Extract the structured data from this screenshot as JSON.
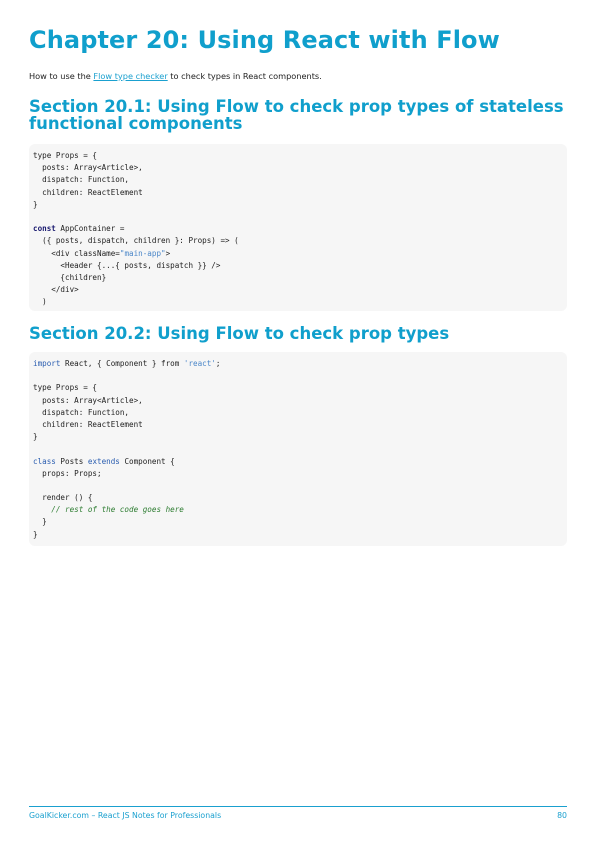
{
  "chapter": {
    "title": "Chapter 20: Using React with Flow"
  },
  "intro": {
    "before": "How to use the ",
    "link": "Flow type checker",
    "after": " to check types in React components."
  },
  "sections": [
    {
      "title": "Section 20.1: Using Flow to check prop types of stateless functional components",
      "code": [
        [
          [
            "",
            "type Props = {"
          ]
        ],
        [
          [
            "",
            "  posts: Array<Article>,"
          ]
        ],
        [
          [
            "",
            "  dispatch: Function,"
          ]
        ],
        [
          [
            "",
            "  children: ReactElement"
          ]
        ],
        [
          [
            "",
            "}"
          ]
        ],
        [
          [
            "",
            ""
          ]
        ],
        [
          [
            "kw",
            "const"
          ],
          [
            "",
            " AppContainer ="
          ]
        ],
        [
          [
            "",
            "  ({ posts, dispatch, children }: Props) => ("
          ]
        ],
        [
          [
            "",
            "    <div className="
          ],
          [
            "str",
            "\"main-app\""
          ],
          [
            "",
            ">"
          ]
        ],
        [
          [
            "",
            "      <Header {...{ posts, dispatch }} />"
          ]
        ],
        [
          [
            "",
            "      {children}"
          ]
        ],
        [
          [
            "",
            "    </div>"
          ]
        ],
        [
          [
            "",
            "  )"
          ]
        ]
      ]
    },
    {
      "title": "Section 20.2: Using Flow to check prop types",
      "code": [
        [
          [
            "kw2",
            "import"
          ],
          [
            "",
            " React, { Component } from "
          ],
          [
            "str",
            "'react'"
          ],
          [
            "",
            ";"
          ]
        ],
        [
          [
            "",
            ""
          ]
        ],
        [
          [
            "",
            "type Props = {"
          ]
        ],
        [
          [
            "",
            "  posts: Array<Article>,"
          ]
        ],
        [
          [
            "",
            "  dispatch: Function,"
          ]
        ],
        [
          [
            "",
            "  children: ReactElement"
          ]
        ],
        [
          [
            "",
            "}"
          ]
        ],
        [
          [
            "",
            ""
          ]
        ],
        [
          [
            "kw2",
            "class"
          ],
          [
            "",
            " Posts "
          ],
          [
            "kw2",
            "extends"
          ],
          [
            "",
            " Component {"
          ]
        ],
        [
          [
            "",
            "  props: Props;"
          ]
        ],
        [
          [
            "",
            ""
          ]
        ],
        [
          [
            "",
            "  render () {"
          ]
        ],
        [
          [
            "cm",
            "    // rest of the code goes here"
          ]
        ],
        [
          [
            "",
            "  }"
          ]
        ],
        [
          [
            "",
            "}"
          ]
        ]
      ]
    }
  ],
  "footer": {
    "left": "GoalKicker.com – React JS Notes for Professionals",
    "page": "80"
  },
  "colors": {
    "accent": "#109fcc",
    "code_bg": "#f6f6f6",
    "keyword": "#1a1a70",
    "string": "#4a86c8",
    "comment": "#2e7d32"
  }
}
